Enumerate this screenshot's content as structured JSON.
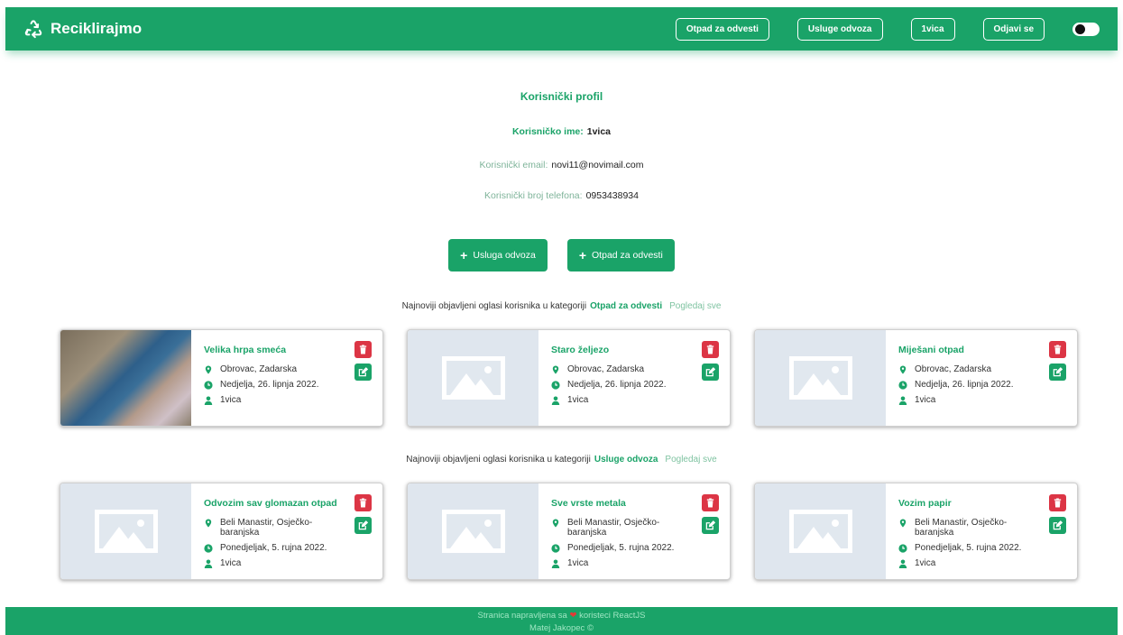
{
  "navbar": {
    "brand": "Reciklirajmo",
    "links": [
      "Otpad za odvesti",
      "Usluge odvoza",
      "1vica",
      "Odjavi se"
    ]
  },
  "profile": {
    "title": "Korisnički profil",
    "username_label": "Korisničko ime:",
    "username": "1vica",
    "email_label": "Korisnički email:",
    "email": "novi11@novimail.com",
    "phone_label": "Korisnički broj telefona:",
    "phone": "0953438934"
  },
  "actions": {
    "service": "Usluga odvoza",
    "waste": "Otpad za odvesti"
  },
  "section_waste": {
    "prefix": "Najnoviji objavljeni oglasi korisnika u kategoriji",
    "category": "Otpad za odvesti",
    "see_all": "Pogledaj sve",
    "cards": [
      {
        "title": "Velika hrpa smeća",
        "location": "Obrovac, Zadarska",
        "date": "Nedjelja, 26. lipnja 2022.",
        "user": "1vica"
      },
      {
        "title": "Staro željezo",
        "location": "Obrovac, Zadarska",
        "date": "Nedjelja, 26. lipnja 2022.",
        "user": "1vica"
      },
      {
        "title": "Miješani otpad",
        "location": "Obrovac, Zadarska",
        "date": "Nedjelja, 26. lipnja 2022.",
        "user": "1vica"
      }
    ]
  },
  "section_services": {
    "prefix": "Najnoviji objavljeni oglasi korisnika u kategoriji",
    "category": "Usluge odvoza",
    "see_all": "Pogledaj sve",
    "cards": [
      {
        "title": "Odvozim sav glomazan otpad",
        "location": "Beli Manastir, Osječko-baranjska",
        "date": "Ponedjeljak, 5. rujna 2022.",
        "user": "1vica"
      },
      {
        "title": "Sve vrste metala",
        "location": "Beli Manastir, Osječko-baranjska",
        "date": "Ponedjeljak, 5. rujna 2022.",
        "user": "1vica"
      },
      {
        "title": "Vozim papir",
        "location": "Beli Manastir, Osječko-baranjska",
        "date": "Ponedjeljak, 5. rujna 2022.",
        "user": "1vica"
      }
    ]
  },
  "footer": {
    "line1_a": "Stranica napravljena sa",
    "line1_b": "koristeci ReactJS",
    "line2": "Matej Jakopec ©"
  },
  "colors": {
    "primary": "#1aa368",
    "danger": "#dc3545"
  }
}
